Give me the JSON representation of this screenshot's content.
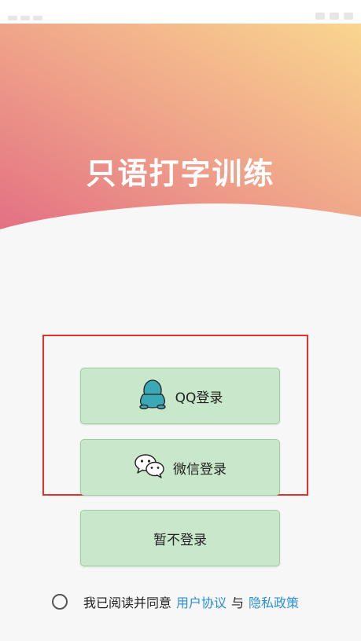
{
  "app": {
    "title": "只语打字训练"
  },
  "login": {
    "qq_label": "QQ登录",
    "wechat_label": "微信登录",
    "skip_label": "暂不登录"
  },
  "agreement": {
    "prefix": "我已阅读并同意",
    "user_agreement": "用户协议",
    "conjunction": "与",
    "privacy_policy": "隐私政策",
    "checked": false
  },
  "colors": {
    "gradient_left": "#e37083",
    "gradient_right": "#f9d68f",
    "button_bg": "#c9e7cb",
    "button_border": "#9ccf9f",
    "highlight_border": "#e3322e",
    "link": "#2b8fd4",
    "qq_icon": "#3aa8b5"
  },
  "icons": {
    "qq": "qq-penguin-icon",
    "wechat": "wechat-bubbles-icon",
    "radio": "radio-unchecked-icon"
  }
}
